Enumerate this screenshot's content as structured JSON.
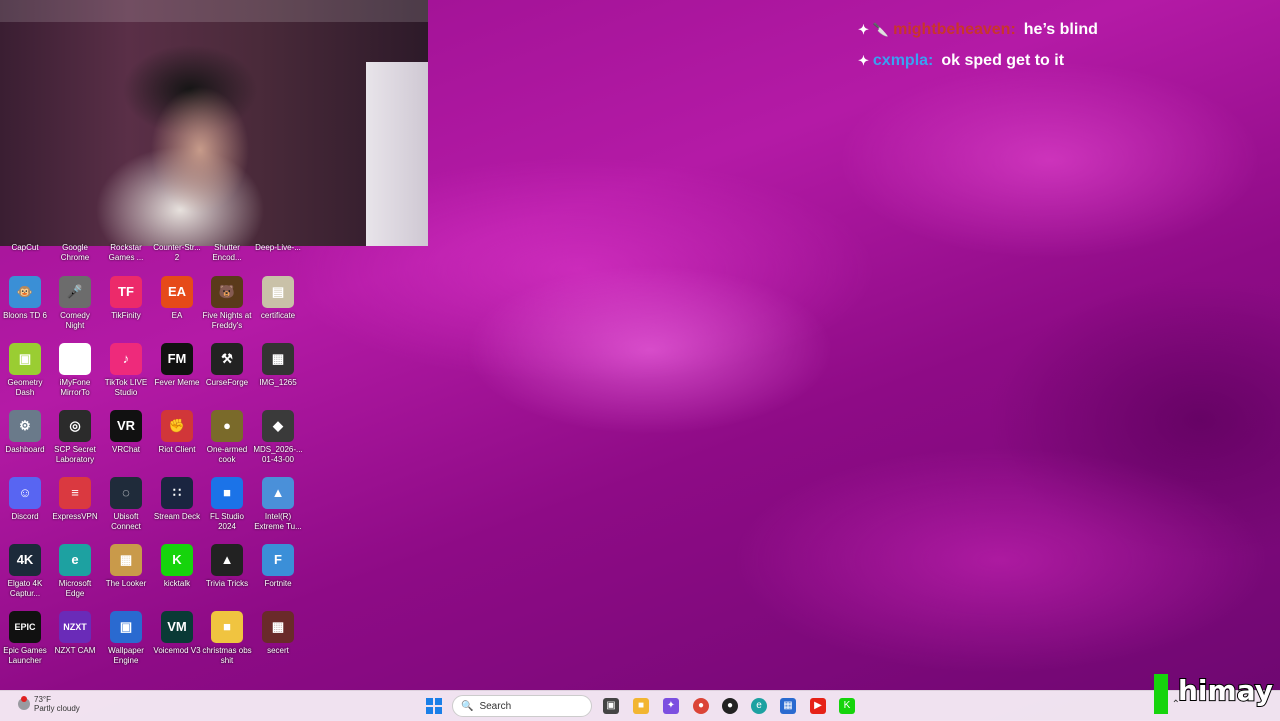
{
  "chat": [
    {
      "user": "mightbeheaven:",
      "message": "he’s blind",
      "user_color": "#c9352b",
      "badges": [
        "🔪",
        "✦"
      ]
    },
    {
      "user": "cxmpla:",
      "message": "ok sped get to it",
      "user_color": "#3aa0f2",
      "badges": [
        "✦"
      ]
    }
  ],
  "desktop_icons_row0": [
    "CapCut",
    "Google Chrome",
    "Rockstar Games ...",
    "Counter-Str... 2",
    "Shutter Encod...",
    "Deep-Live-..."
  ],
  "desktop_icons": [
    {
      "label": "Bloons TD 6",
      "glyph": "🐵",
      "color": "#3a8fd6"
    },
    {
      "label": "Comedy Night",
      "glyph": "🎤",
      "color": "#6c6c6c"
    },
    {
      "label": "TikFinity",
      "glyph": "TF",
      "color": "#ec2a6a"
    },
    {
      "label": "EA",
      "glyph": "EA",
      "color": "#e64a19"
    },
    {
      "label": "Five Nights at Freddy's",
      "glyph": "🐻",
      "color": "#5a3a1a"
    },
    {
      "label": "certificate",
      "glyph": "▤",
      "color": "#c9c1a8"
    },
    {
      "label": "Geometry Dash",
      "glyph": "▣",
      "color": "#9acd32"
    },
    {
      "label": "iMyFone MirrorTo",
      "glyph": "▢",
      "color": "#ffffff"
    },
    {
      "label": "TikTok LIVE Studio",
      "glyph": "♪",
      "color": "#ee2a7b"
    },
    {
      "label": "Fever Meme",
      "glyph": "FM",
      "color": "#111111"
    },
    {
      "label": "CurseForge",
      "glyph": "⚒",
      "color": "#222222"
    },
    {
      "label": "IMG_1265",
      "glyph": "▦",
      "color": "#333333"
    },
    {
      "label": "Dashboard",
      "glyph": "⚙",
      "color": "#6a7a8a"
    },
    {
      "label": "SCP Secret Laboratory",
      "glyph": "◎",
      "color": "#2b2b2b"
    },
    {
      "label": "VRChat",
      "glyph": "VR",
      "color": "#111111"
    },
    {
      "label": "Riot Client",
      "glyph": "✊",
      "color": "#d13639"
    },
    {
      "label": "One-armed cook",
      "glyph": "●",
      "color": "#7a6a2a"
    },
    {
      "label": "MDS_2026-... 01-43-00",
      "glyph": "◆",
      "color": "#3a3a3a"
    },
    {
      "label": "Discord",
      "glyph": "☺",
      "color": "#5865f2"
    },
    {
      "label": "ExpressVPN",
      "glyph": "≡",
      "color": "#da3940"
    },
    {
      "label": "Ubisoft Connect",
      "glyph": "◌",
      "color": "#1f2b3a"
    },
    {
      "label": "Stream Deck",
      "glyph": "∷",
      "color": "#1a2540"
    },
    {
      "label": "FL Studio 2024",
      "glyph": "■",
      "color": "#1b73e8"
    },
    {
      "label": "Intel(R) Extreme Tu...",
      "glyph": "▲",
      "color": "#4a90d9"
    },
    {
      "label": "Elgato 4K Captur...",
      "glyph": "4K",
      "color": "#1c2a3a"
    },
    {
      "label": "Microsoft Edge",
      "glyph": "e",
      "color": "#1da1a1"
    },
    {
      "label": "The Looker",
      "glyph": "▦",
      "color": "#c99a4a"
    },
    {
      "label": "kicktalk",
      "glyph": "K",
      "color": "#16d40c"
    },
    {
      "label": "Trivia Tricks",
      "glyph": "▲",
      "color": "#222222"
    },
    {
      "label": "Fortnite",
      "glyph": "F",
      "color": "#3b8fd8"
    },
    {
      "label": "Epic Games Launcher",
      "glyph": "EPIC",
      "color": "#111111"
    },
    {
      "label": "NZXT CAM",
      "glyph": "NZXT",
      "color": "#6a2bb8"
    },
    {
      "label": "Wallpaper Engine",
      "glyph": "▣",
      "color": "#2a6ad0"
    },
    {
      "label": "Voicemod V3",
      "glyph": "VM",
      "color": "#0a3a36"
    },
    {
      "label": "christmas obs shit",
      "glyph": "■",
      "color": "#f0c440"
    },
    {
      "label": "secert",
      "glyph": "▦",
      "color": "#6a2a2a"
    }
  ],
  "taskbar": {
    "weather_temp": "73°F",
    "weather_desc": "Partly cloudy",
    "search_label": "Search",
    "apps": [
      "file-explorer-icon",
      "folder-icon",
      "copilot-icon",
      "chrome-icon",
      "obs-icon",
      "edge-icon",
      "store-icon",
      "youtube-icon",
      "kick-icon"
    ]
  },
  "logo_text": "himay",
  "colors": {
    "accent_green": "#16d40c",
    "windows_blue": "#1a7fe8"
  }
}
